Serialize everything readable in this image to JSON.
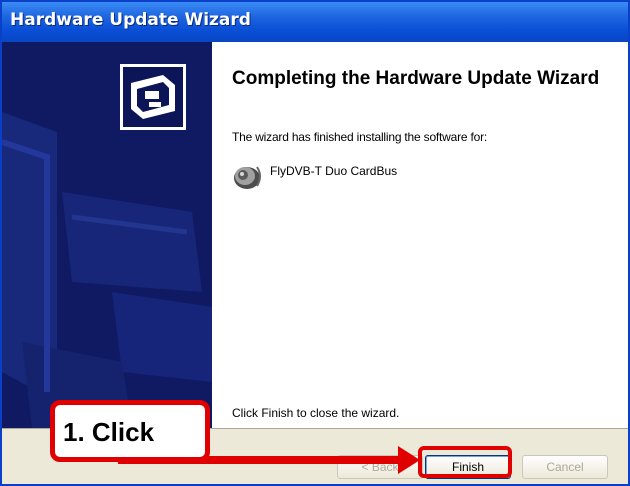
{
  "window": {
    "title": "Hardware Update Wizard"
  },
  "content": {
    "heading": "Completing the Hardware Update Wizard",
    "description": "The wizard has finished installing the software for:",
    "device_name": "FlyDVB-T Duo CardBus",
    "finish_note": "Click Finish to close the wizard."
  },
  "buttons": {
    "back_label": "< Back",
    "finish_label": "Finish",
    "cancel_label": "Cancel"
  },
  "annotation": {
    "callout_text": "1. Click"
  },
  "colors": {
    "titlebar": "#0a4fd6",
    "side_panel": "#101c66",
    "annotation_red": "#e10000"
  },
  "icons": {
    "wizard": "hardware-card-icon",
    "device": "speaker-icon"
  }
}
